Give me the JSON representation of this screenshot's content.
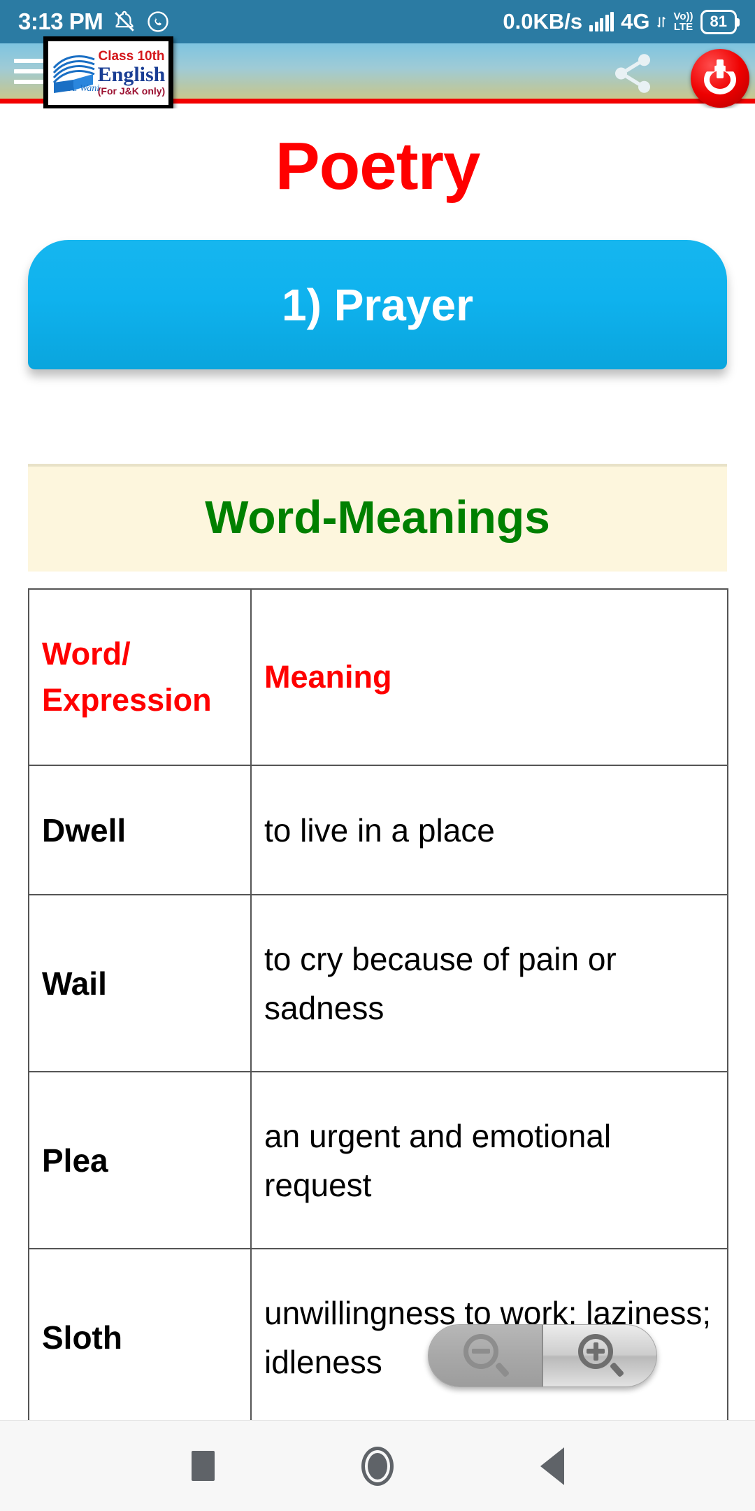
{
  "status_bar": {
    "time": "3:13 PM",
    "notification_icons": [
      "mute-notification-icon",
      "whatsapp-icon"
    ],
    "network_speed": "0.0KB/s",
    "signal_icon": "signal-bars-icon",
    "network_type": "4G",
    "volte_line1": "Vo))",
    "volte_line2": "LTE",
    "battery_percent": "81"
  },
  "app_bar": {
    "menu_icon": "hamburger-menu-icon",
    "logo": {
      "class_label": "Class 10th",
      "subject": "English",
      "region_note": "(For J&K only)",
      "signature": "T. A. Wani",
      "book_icon": "open-book-icon"
    },
    "share_icon": "share-icon",
    "power_icon": "power-exit-icon"
  },
  "main": {
    "page_title": "Poetry",
    "chapter_button": "1) Prayer",
    "section_heading": "Word-Meanings",
    "table": {
      "headers": [
        "Word/ Expression",
        "Meaning"
      ],
      "header_word_line1": "Word/",
      "header_word_line2": "Expression",
      "header_meaning": "Meaning",
      "rows": [
        {
          "word": "Dwell",
          "meaning": "to live in a place"
        },
        {
          "word": "Wail",
          "meaning": "to cry because of pain or sadness"
        },
        {
          "word": "Plea",
          "meaning": "an urgent and emotional request"
        },
        {
          "word": "Sloth",
          "meaning": "unwillingness to work; laziness; idleness"
        }
      ]
    }
  },
  "zoom_control": {
    "zoom_out_icon": "zoom-out-magnifier-icon",
    "zoom_in_icon": "zoom-in-magnifier-icon"
  },
  "nav_bar": {
    "recent_icon": "recent-apps-icon",
    "home_icon": "home-icon",
    "back_icon": "back-icon"
  },
  "colors": {
    "status_bar": "#2b7ba3",
    "title_red": "#ff0000",
    "button_blue": "#0fb2ee",
    "heading_green": "#008000",
    "band_cream": "#fdf6dd",
    "accent_rule": "#f20000"
  }
}
